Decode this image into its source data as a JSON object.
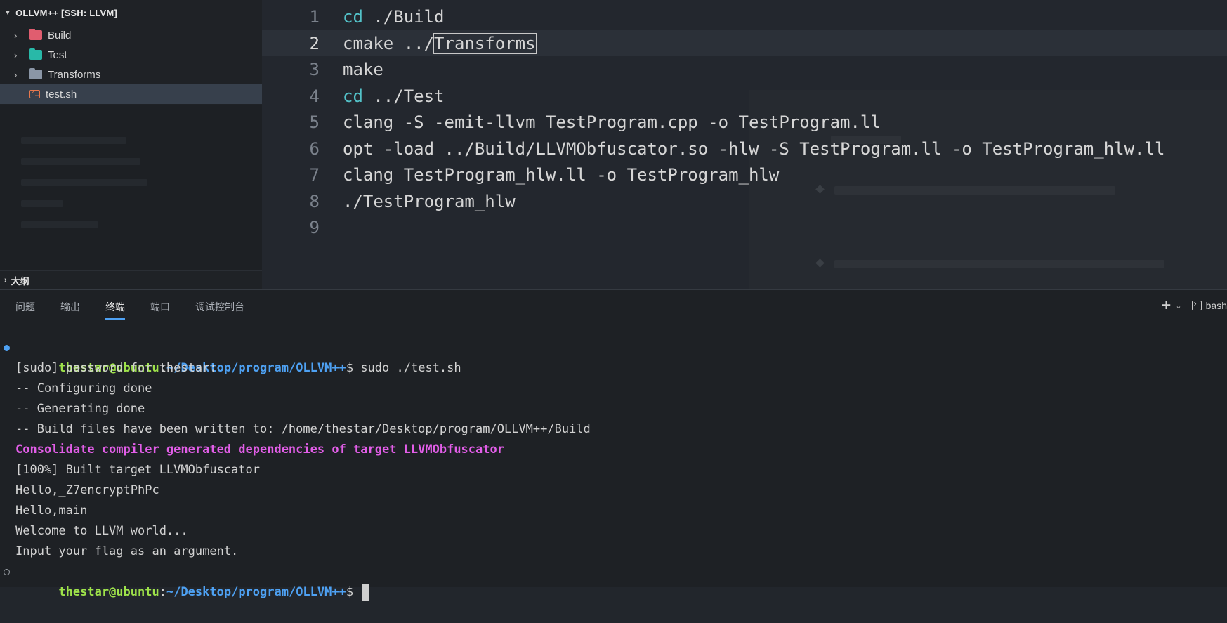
{
  "explorer": {
    "title": "OLLVM++ [SSH: LLVM]",
    "items": [
      {
        "label": "Build",
        "type": "folder",
        "icon": "folder-red-icon"
      },
      {
        "label": "Test",
        "type": "folder",
        "icon": "folder-teal-icon"
      },
      {
        "label": "Transforms",
        "type": "folder",
        "icon": "folder-gray-icon"
      },
      {
        "label": "test.sh",
        "type": "file",
        "icon": "shell-file-icon",
        "selected": true
      }
    ],
    "outline_label": "大纲"
  },
  "editor": {
    "lines": [
      {
        "n": "1",
        "kw": "cd",
        "rest": " ./Build"
      },
      {
        "n": "2",
        "pre": "cmake ../",
        "boxed": "Transforms",
        "current": true
      },
      {
        "n": "3",
        "text": "make"
      },
      {
        "n": "4",
        "kw": "cd",
        "rest": " ../Test"
      },
      {
        "n": "5",
        "text": "clang -S -emit-llvm TestProgram.cpp -o TestProgram.ll"
      },
      {
        "n": "6",
        "text": "opt -load ../Build/LLVMObfuscator.so -hlw -S TestProgram.ll -o TestProgram_hlw.ll"
      },
      {
        "n": "7",
        "text": "clang TestProgram_hlw.ll -o TestProgram_hlw"
      },
      {
        "n": "8",
        "text": "./TestProgram_hlw"
      },
      {
        "n": "9",
        "text": ""
      }
    ]
  },
  "panel": {
    "tabs": [
      "问题",
      "输出",
      "终端",
      "端口",
      "调试控制台"
    ],
    "active_tab": "终端",
    "shell_label": "bash"
  },
  "terminal": {
    "prompt_user": "thestar@ubuntu",
    "prompt_path": "~/Desktop/program/OLLVM++",
    "prompt_symbol": "$",
    "command": " sudo ./test.sh",
    "output": [
      "[sudo] password for thestar:",
      "-- Configuring done",
      "-- Generating done",
      "-- Build files have been written to: /home/thestar/Desktop/program/OLLVM++/Build",
      "Consolidate compiler generated dependencies of target LLVMObfuscator",
      "[100%] Built target LLVMObfuscator",
      "Hello,_Z7encryptPhPc",
      "Hello,main",
      "Welcome to LLVM world...",
      "Input your flag as an argument."
    ],
    "highlight_index": 4
  },
  "colors": {
    "accent": "#4ea1f3",
    "prompt_user": "#9ee24a",
    "keyword": "#53c2c9",
    "highlight": "#e25ee8"
  }
}
